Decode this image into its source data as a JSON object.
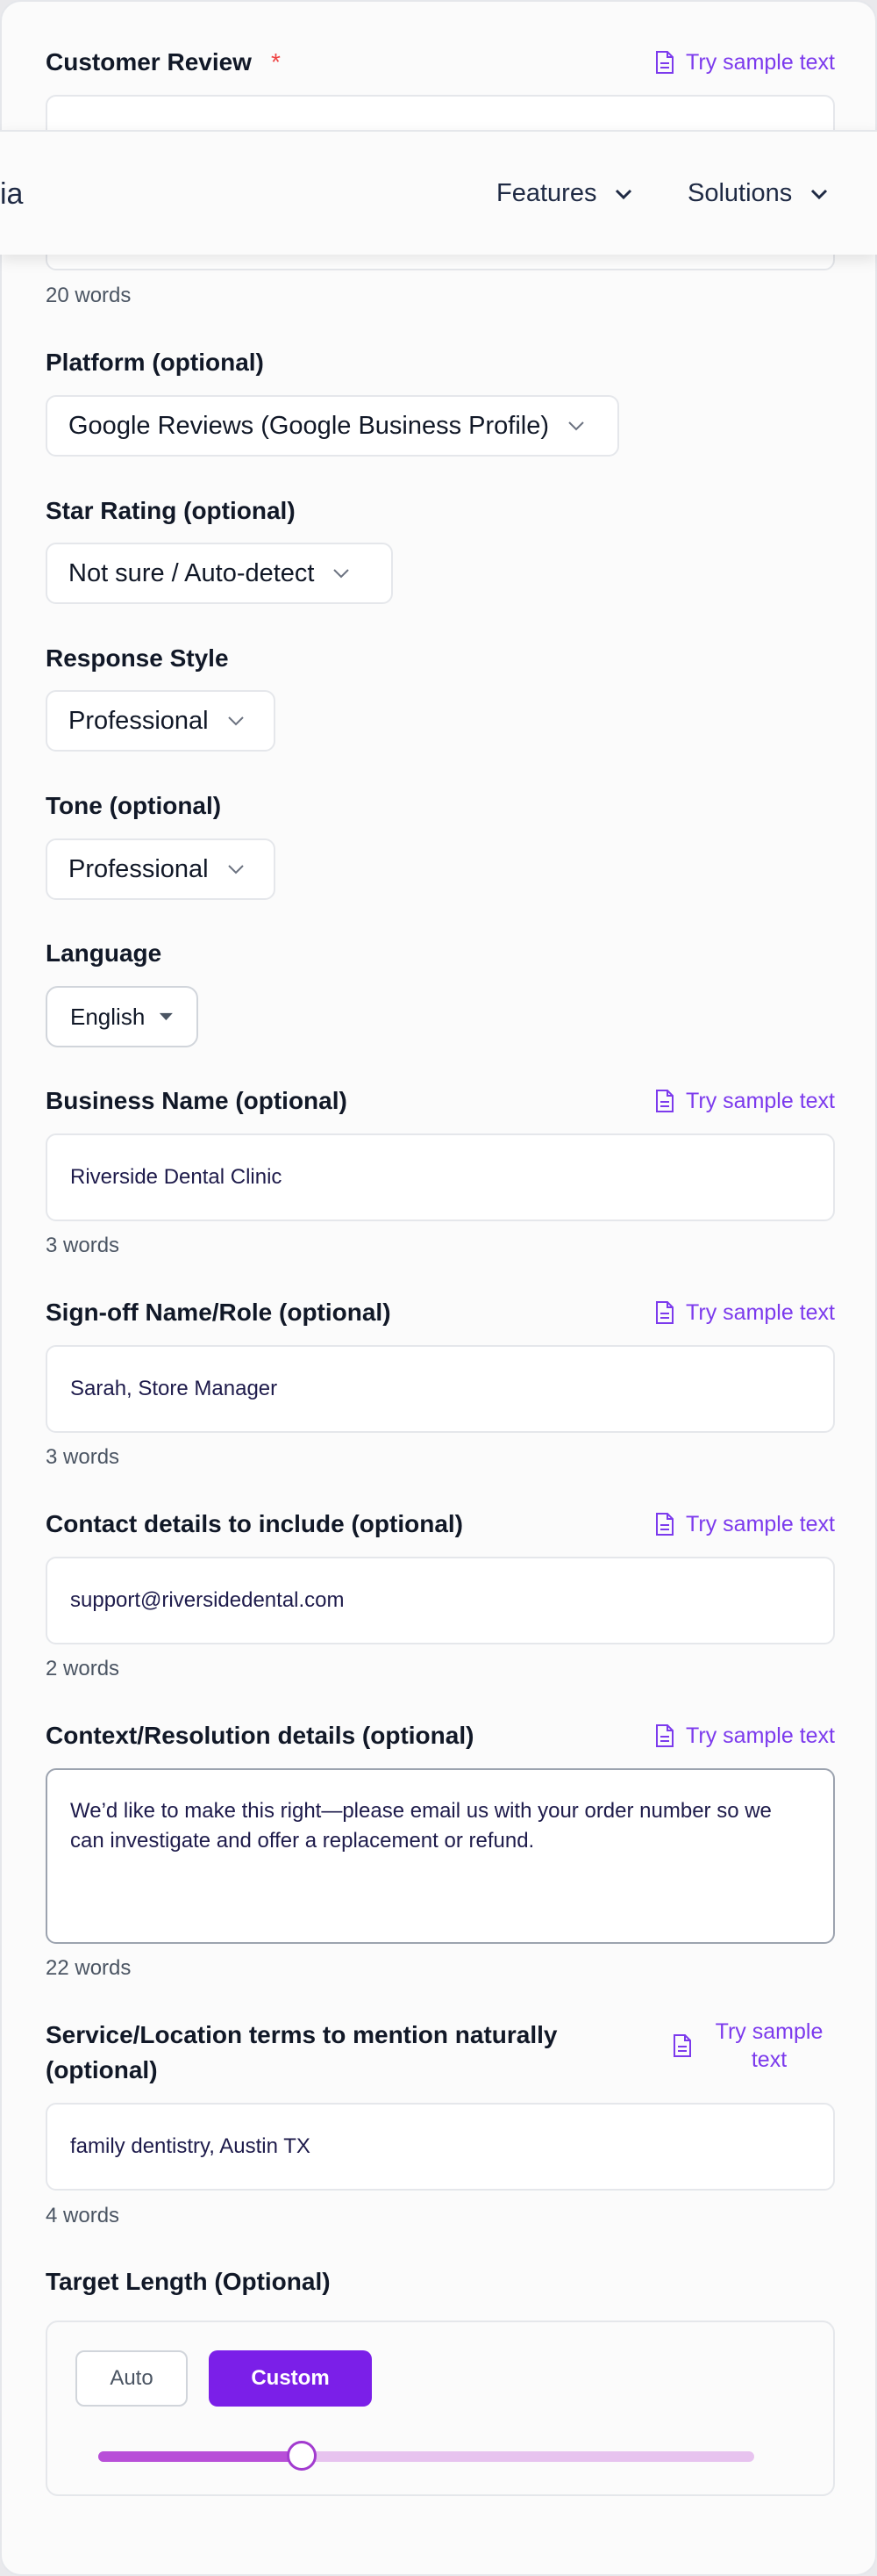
{
  "customer_review": {
    "label": "Customer Review",
    "required_mark": "*",
    "sample_label": "Try sample text",
    "word_count": "20 words"
  },
  "nav": {
    "logo": "ia",
    "features": "Features",
    "solutions": "Solutions"
  },
  "platform": {
    "label": "Platform (optional)",
    "value": "Google Reviews (Google Business Profile)"
  },
  "star_rating": {
    "label": "Star Rating (optional)",
    "value": "Not sure / Auto-detect"
  },
  "response_style": {
    "label": "Response Style",
    "value": "Professional"
  },
  "tone": {
    "label": "Tone (optional)",
    "value": "Professional"
  },
  "language": {
    "label": "Language",
    "value": "English"
  },
  "business_name": {
    "label": "Business Name (optional)",
    "sample_label": "Try sample text",
    "value": "Riverside Dental Clinic",
    "word_count": "3 words"
  },
  "signoff": {
    "label": "Sign-off Name/Role (optional)",
    "sample_label": "Try sample text",
    "value": "Sarah, Store Manager",
    "word_count": "3 words"
  },
  "contact": {
    "label": "Contact details to include (optional)",
    "sample_label": "Try sample text",
    "value": "support@riversidedental.com",
    "word_count": "2 words"
  },
  "context": {
    "label": "Context/Resolution details (optional)",
    "sample_label": "Try sample text",
    "value": "We’d like to make this right—please email us with your order number so we can investigate and offer a replacement or refund.",
    "word_count": "22 words"
  },
  "service_terms": {
    "label": "Service/Location terms to mention naturally (optional)",
    "sample_label": "Try sample text",
    "value": "family dentistry, Austin TX",
    "word_count": "4 words"
  },
  "target_length": {
    "label": "Target Length (Optional)",
    "auto_label": "Auto",
    "custom_label": "Custom",
    "slider_fraction": 0.31
  },
  "colors": {
    "accent": "#7c3aed",
    "button_primary": "#7b1fe8",
    "required": "#ef4444"
  }
}
